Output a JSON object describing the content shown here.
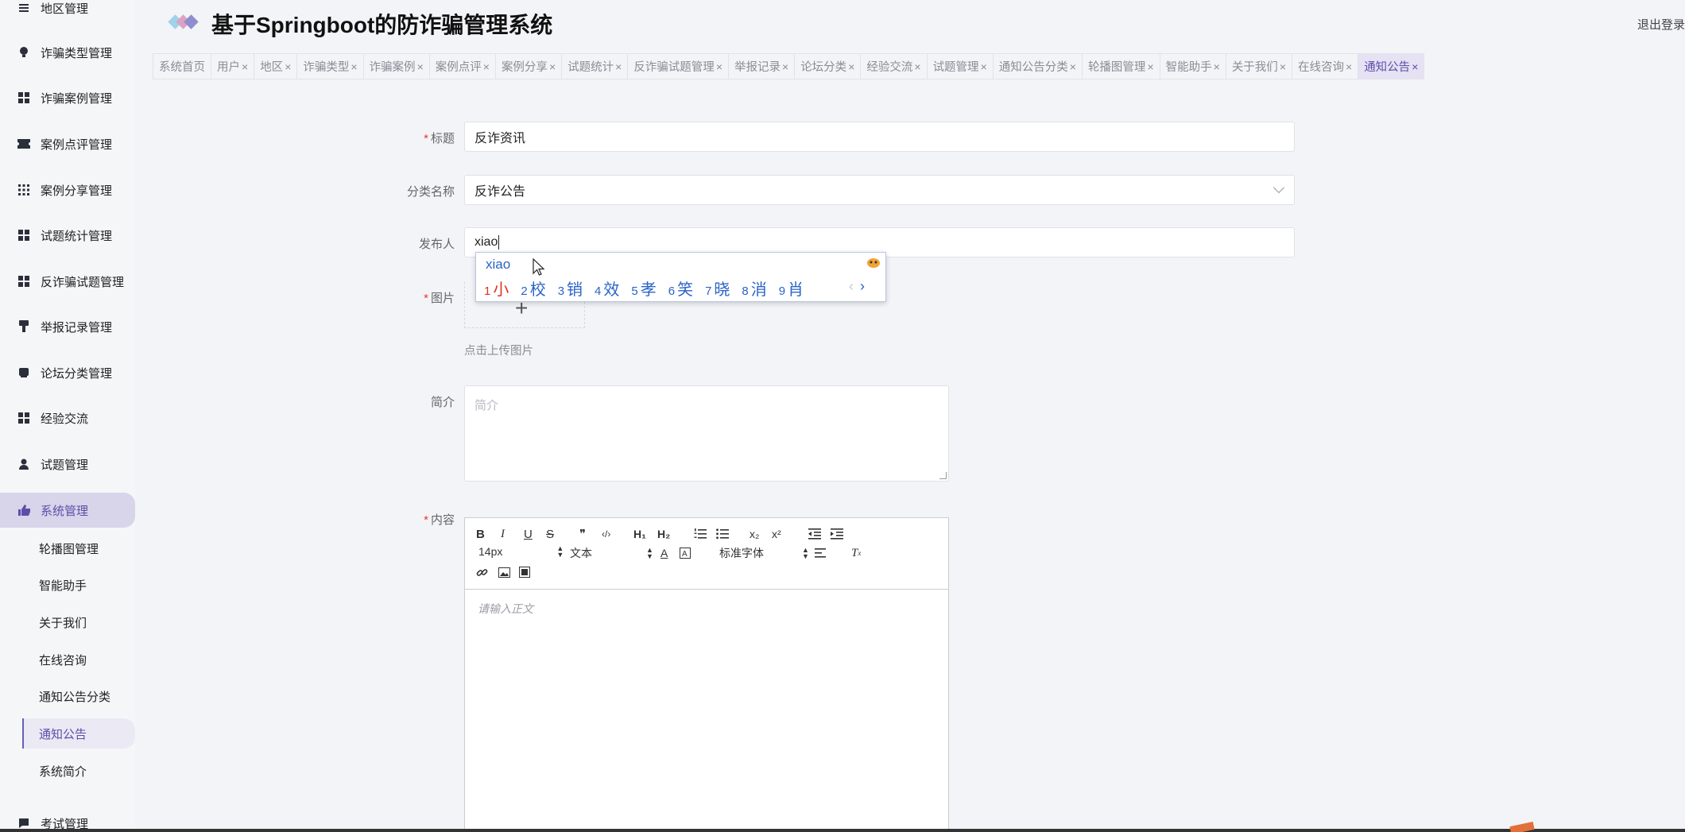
{
  "app": {
    "title": "基于Springboot的防诈骗管理系统",
    "logout": "退出登录"
  },
  "sidebar": {
    "items": [
      {
        "label": "地区管理",
        "icon": "list-icon"
      },
      {
        "label": "诈骗类型管理",
        "icon": "bulb-icon"
      },
      {
        "label": "诈骗案例管理",
        "icon": "grid-icon"
      },
      {
        "label": "案例点评管理",
        "icon": "ticket-icon"
      },
      {
        "label": "案例分享管理",
        "icon": "apps-icon"
      },
      {
        "label": "试题统计管理",
        "icon": "grid-icon"
      },
      {
        "label": "反诈骗试题管理",
        "icon": "grid-icon"
      },
      {
        "label": "举报记录管理",
        "icon": "award-icon"
      },
      {
        "label": "论坛分类管理",
        "icon": "tag-icon"
      },
      {
        "label": "经验交流",
        "icon": "grid-icon"
      },
      {
        "label": "试题管理",
        "icon": "user-icon"
      },
      {
        "label": "系统管理",
        "icon": "thumb-icon"
      }
    ],
    "sub_items": [
      {
        "label": "轮播图管理"
      },
      {
        "label": "智能助手"
      },
      {
        "label": "关于我们"
      },
      {
        "label": "在线咨询"
      },
      {
        "label": "通知公告分类"
      },
      {
        "label": "通知公告"
      },
      {
        "label": "系统简介"
      }
    ],
    "bottom_item": {
      "label": "考试管理",
      "icon": "chat-icon"
    }
  },
  "tabs": [
    {
      "label": "系统首页",
      "closable": false
    },
    {
      "label": "用户",
      "closable": true
    },
    {
      "label": "地区",
      "closable": true
    },
    {
      "label": "诈骗类型",
      "closable": true
    },
    {
      "label": "诈骗案例",
      "closable": true
    },
    {
      "label": "案例点评",
      "closable": true
    },
    {
      "label": "案例分享",
      "closable": true
    },
    {
      "label": "试题统计",
      "closable": true
    },
    {
      "label": "反诈骗试题管理",
      "closable": true
    },
    {
      "label": "举报记录",
      "closable": true
    },
    {
      "label": "论坛分类",
      "closable": true
    },
    {
      "label": "经验交流",
      "closable": true
    },
    {
      "label": "试题管理",
      "closable": true
    },
    {
      "label": "通知公告分类",
      "closable": true
    },
    {
      "label": "轮播图管理",
      "closable": true
    },
    {
      "label": "智能助手",
      "closable": true
    },
    {
      "label": "关于我们",
      "closable": true
    },
    {
      "label": "在线咨询",
      "closable": true
    },
    {
      "label": "通知公告",
      "closable": true,
      "active": true
    }
  ],
  "tab_close_glyph": "×",
  "form": {
    "required_mark": "*",
    "title_label": "标题",
    "title_value": "反诈资讯",
    "category_label": "分类名称",
    "category_value": "反诈公告",
    "publisher_label": "发布人",
    "publisher_value": "xiao",
    "image_label": "图片",
    "upload_plus": "+",
    "upload_hint": "点击上传图片",
    "summary_label": "简介",
    "summary_placeholder": "简介",
    "content_label": "内容"
  },
  "ime": {
    "composition": "xiao",
    "candidates": [
      {
        "n": "1",
        "c": "小"
      },
      {
        "n": "2",
        "c": "校"
      },
      {
        "n": "3",
        "c": "销"
      },
      {
        "n": "4",
        "c": "效"
      },
      {
        "n": "5",
        "c": "孝"
      },
      {
        "n": "6",
        "c": "笑"
      },
      {
        "n": "7",
        "c": "晓"
      },
      {
        "n": "8",
        "c": "消"
      },
      {
        "n": "9",
        "c": "肖"
      }
    ],
    "prev": "‹",
    "next": "›"
  },
  "editor": {
    "toolbar": {
      "bold": "B",
      "italic": "I",
      "underline": "U",
      "strike": "S",
      "quote": "❞",
      "code": "‹/›",
      "h1": "H₁",
      "h2": "H₂",
      "sub": "x₂",
      "sup": "x²",
      "size_value": "14px",
      "header_value": "文本",
      "font_value": "标准字体"
    },
    "placeholder": "请输入正文"
  },
  "colors": {
    "accent": "#5b4ea8",
    "required": "#e53935",
    "ime_blue": "#2a64c7",
    "ime_first": "#e0301e"
  }
}
